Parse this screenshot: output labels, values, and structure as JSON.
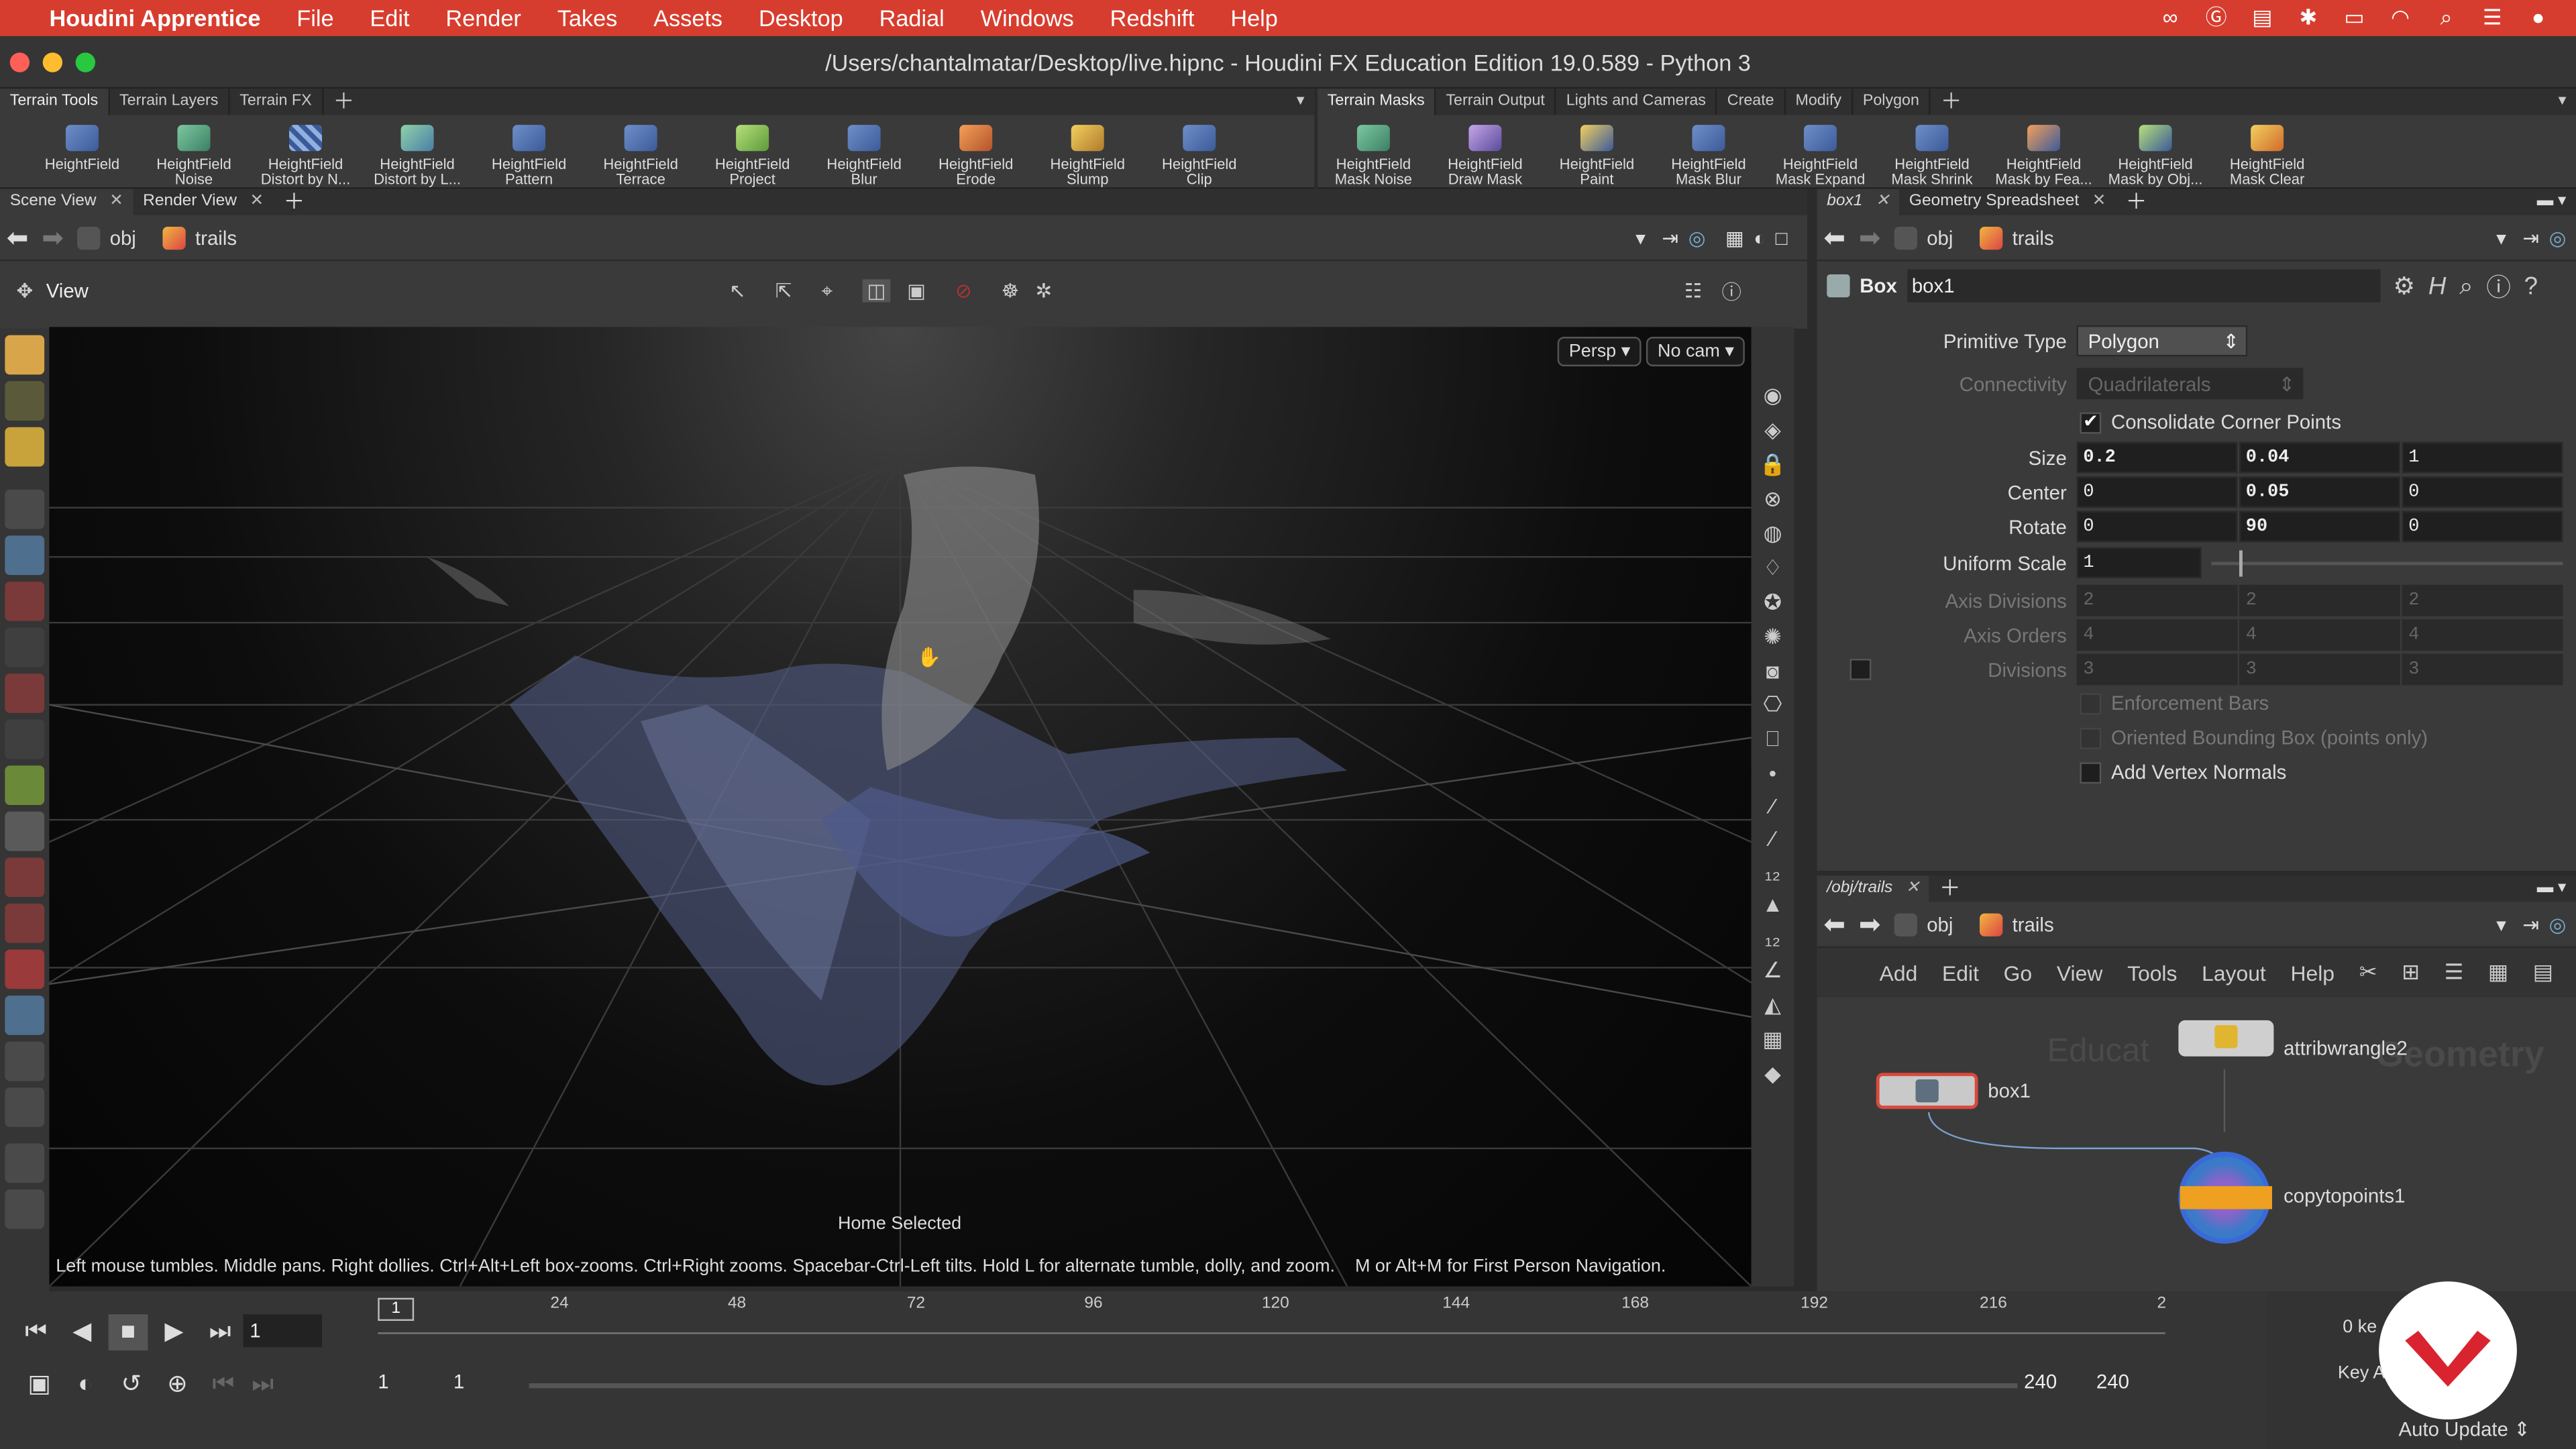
{
  "menubar": {
    "app": "Houdini Apprentice",
    "items": [
      "File",
      "Edit",
      "Render",
      "Takes",
      "Assets",
      "Desktop",
      "Radial",
      "Windows",
      "Redshift",
      "Help"
    ]
  },
  "window_title": "/Users/chantalmatar/Desktop/live.hipnc - Houdini FX Education Edition 19.0.589 - Python 3",
  "shelf_left": {
    "tabs": [
      "Terrain Tools",
      "Terrain Layers",
      "Terrain FX"
    ],
    "tools": [
      {
        "line1": "",
        "line2": "HeightField"
      },
      {
        "line1": "HeightField",
        "line2": "Noise"
      },
      {
        "line1": "HeightField",
        "line2": "Distort by N..."
      },
      {
        "line1": "HeightField",
        "line2": "Distort by L..."
      },
      {
        "line1": "HeightField",
        "line2": "Pattern"
      },
      {
        "line1": "HeightField",
        "line2": "Terrace"
      },
      {
        "line1": "HeightField",
        "line2": "Project"
      },
      {
        "line1": "HeightField",
        "line2": "Blur"
      },
      {
        "line1": "HeightField",
        "line2": "Erode"
      },
      {
        "line1": "HeightField",
        "line2": "Slump"
      },
      {
        "line1": "HeightField",
        "line2": "Clip"
      }
    ]
  },
  "shelf_right": {
    "tabs": [
      "Terrain Masks",
      "Terrain Output",
      "Lights and Cameras",
      "Create",
      "Modify",
      "Polygon"
    ],
    "tools": [
      {
        "line1": "HeightField",
        "line2": "Mask Noise"
      },
      {
        "line1": "HeightField",
        "line2": "Draw Mask"
      },
      {
        "line1": "HeightField",
        "line2": "Paint"
      },
      {
        "line1": "HeightField",
        "line2": "Mask Blur"
      },
      {
        "line1": "HeightField",
        "line2": "Mask Expand"
      },
      {
        "line1": "HeightField",
        "line2": "Mask Shrink"
      },
      {
        "line1": "HeightField",
        "line2": "Mask by Fea..."
      },
      {
        "line1": "HeightField",
        "line2": "Mask by Obj..."
      },
      {
        "line1": "HeightField",
        "line2": "Mask Clear"
      }
    ]
  },
  "scene_pane": {
    "tabs": [
      "Scene View",
      "Render View"
    ],
    "path": {
      "obj": "obj",
      "node": "trails"
    },
    "view_label": "View",
    "persp": "Persp",
    "cam": "No cam",
    "status_center": "Home Selected",
    "hint": "Left mouse tumbles. Middle pans. Right dollies. Ctrl+Alt+Left box-zooms. Ctrl+Right zooms. Spacebar-Ctrl-Left tilts. Hold L for alternate tumble, dolly, and zoom.",
    "hint2": "M or Alt+M for First Person Navigation."
  },
  "param_pane": {
    "tabs": [
      "box1",
      "Geometry Spreadsheet"
    ],
    "path": {
      "obj": "obj",
      "node": "trails"
    },
    "node_type": "Box",
    "node_name": "box1",
    "primitive_type": {
      "label": "Primitive Type",
      "value": "Polygon"
    },
    "connectivity": {
      "label": "Connectivity",
      "value": "Quadrilaterals"
    },
    "consolidate": {
      "label": "Consolidate Corner Points",
      "checked": true
    },
    "size": {
      "label": "Size",
      "values": [
        "0.2",
        "0.04",
        "1"
      ]
    },
    "center": {
      "label": "Center",
      "values": [
        "0",
        "0.05",
        "0"
      ]
    },
    "rotate": {
      "label": "Rotate",
      "values": [
        "0",
        "90",
        "0"
      ]
    },
    "uniform_scale": {
      "label": "Uniform Scale",
      "value": "1"
    },
    "axis_divisions": {
      "label": "Axis Divisions",
      "values": [
        "2",
        "2",
        "2"
      ]
    },
    "axis_orders": {
      "label": "Axis Orders",
      "values": [
        "4",
        "4",
        "4"
      ]
    },
    "divisions": {
      "label": "Divisions",
      "values": [
        "3",
        "3",
        "3"
      ]
    },
    "enforcement_bars": "Enforcement Bars",
    "oriented_bbox": "Oriented Bounding Box (points only)",
    "add_vertex_normals": "Add Vertex Normals"
  },
  "network_pane": {
    "tab": "/obj/trails",
    "path": {
      "obj": "obj",
      "node": "trails"
    },
    "menu": [
      "Add",
      "Edit",
      "Go",
      "View",
      "Tools",
      "Layout",
      "Help"
    ],
    "watermark_left": "Educat",
    "watermark_right": "Geometry",
    "nodes": {
      "box": "box1",
      "wrangle": "attribwrangle2",
      "copy": "copytopoints1"
    }
  },
  "timeline": {
    "current_frame": "1",
    "marker": "1",
    "ticks": [
      "24",
      "48",
      "72",
      "96",
      "120",
      "144",
      "168",
      "192",
      "216",
      "2"
    ],
    "range_start": "1",
    "range_start2": "1",
    "range_end": "240",
    "range_end2": "240",
    "keys": "0 ke",
    "key_all": "Key All",
    "auto_update": "Auto Update"
  },
  "colors": {
    "menubar": "#d73d2e",
    "accent": "#e2412f",
    "node_selected": "#d94a3c"
  }
}
